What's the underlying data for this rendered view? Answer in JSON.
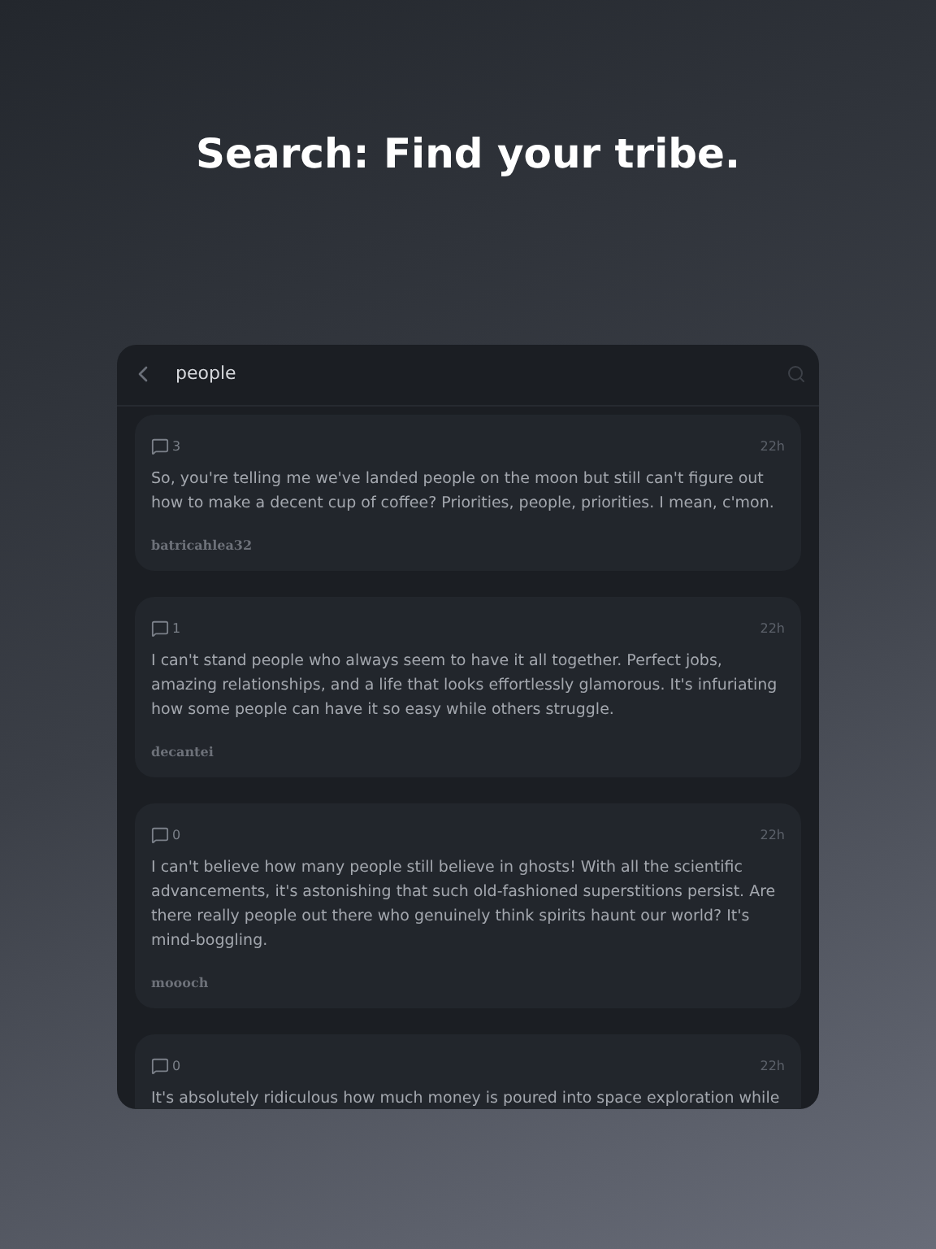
{
  "headline": "Search: Find your tribe.",
  "search": {
    "value": "people"
  },
  "posts": [
    {
      "comments": "3",
      "time": "22h",
      "text": "So, you're telling me we've landed people on the moon but still can't figure out how to make a decent cup of coffee? Priorities, people, priorities. I mean, c'mon.",
      "author": "batricahlea32"
    },
    {
      "comments": "1",
      "time": "22h",
      "text": "I can't stand people who always seem to have it all together. Perfect jobs, amazing relationships, and a life that looks effortlessly glamorous. It's infuriating how some people can have it so easy while others struggle.",
      "author": "decantei"
    },
    {
      "comments": "0",
      "time": "22h",
      "text": "I can't believe how many people still believe in ghosts! With all the scientific advancements, it's astonishing that such old-fashioned superstitions persist. Are there really people out there who genuinely think spirits haunt our world? It's mind-boggling.",
      "author": "moooch"
    },
    {
      "comments": "0",
      "time": "22h",
      "text": "It's absolutely ridiculous how much money is poured into space exploration while"
    }
  ]
}
